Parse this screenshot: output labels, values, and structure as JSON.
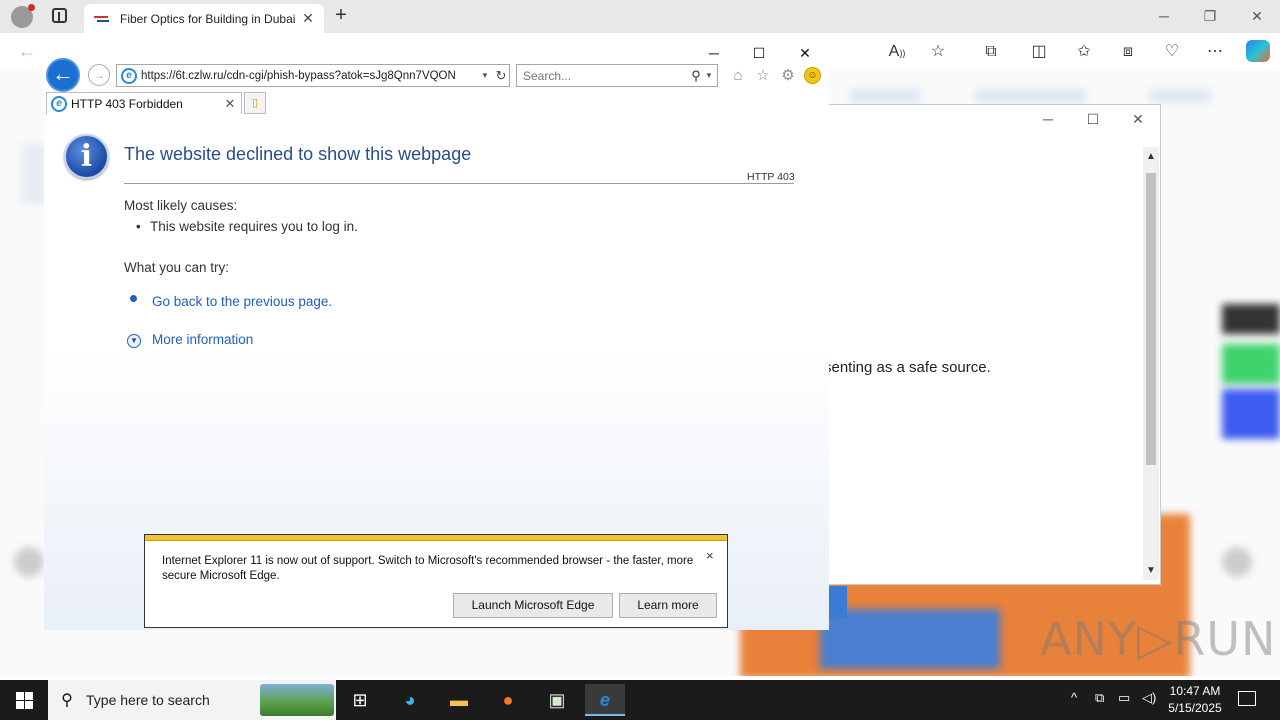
{
  "edge": {
    "tab_title": "Fiber Optics for Building in Dubai",
    "tab_close": "✕",
    "new_tab": "+",
    "win_minimize": "─",
    "win_restore": "❐",
    "win_close": "✕"
  },
  "ie": {
    "url": "https://6t.czlw.ru/cdn-cgi/phish-bypass?atok=sJg8Qnn7VQON",
    "search_placeholder": "Search...",
    "tab_label": "HTTP 403 Forbidden",
    "win_minimize": "─",
    "win_maximize": "☐",
    "win_close": "✕",
    "error": {
      "title": "The website declined to show this webpage",
      "code": "HTTP 403",
      "causes_heading": "Most likely causes:",
      "causes": [
        "This website requires you to log in."
      ],
      "try_heading": "What you can try:",
      "go_back": "Go back to the previous page.",
      "more_info": "More information"
    },
    "notification": {
      "message": "Internet Explorer 11 is now out of support. Switch to Microsoft's recommended browser - the faster, more secure Microsoft Edge.",
      "launch_edge": "Launch Microsoft Edge",
      "learn_more": "Learn more",
      "close": "×"
    }
  },
  "background_dialog": {
    "visible_text": "senting as a safe source.",
    "win_minimize": "─",
    "win_maximize": "☐",
    "win_close": "✕"
  },
  "watermark": "ANY▷RUN",
  "taskbar": {
    "search_placeholder": "Type here to search",
    "time": "10:47 AM",
    "date": "5/15/2025"
  },
  "colors": {
    "ie_title_blue": "#274d8e",
    "link_blue": "#1f5fbf",
    "notify_bar": "#f1c232"
  }
}
